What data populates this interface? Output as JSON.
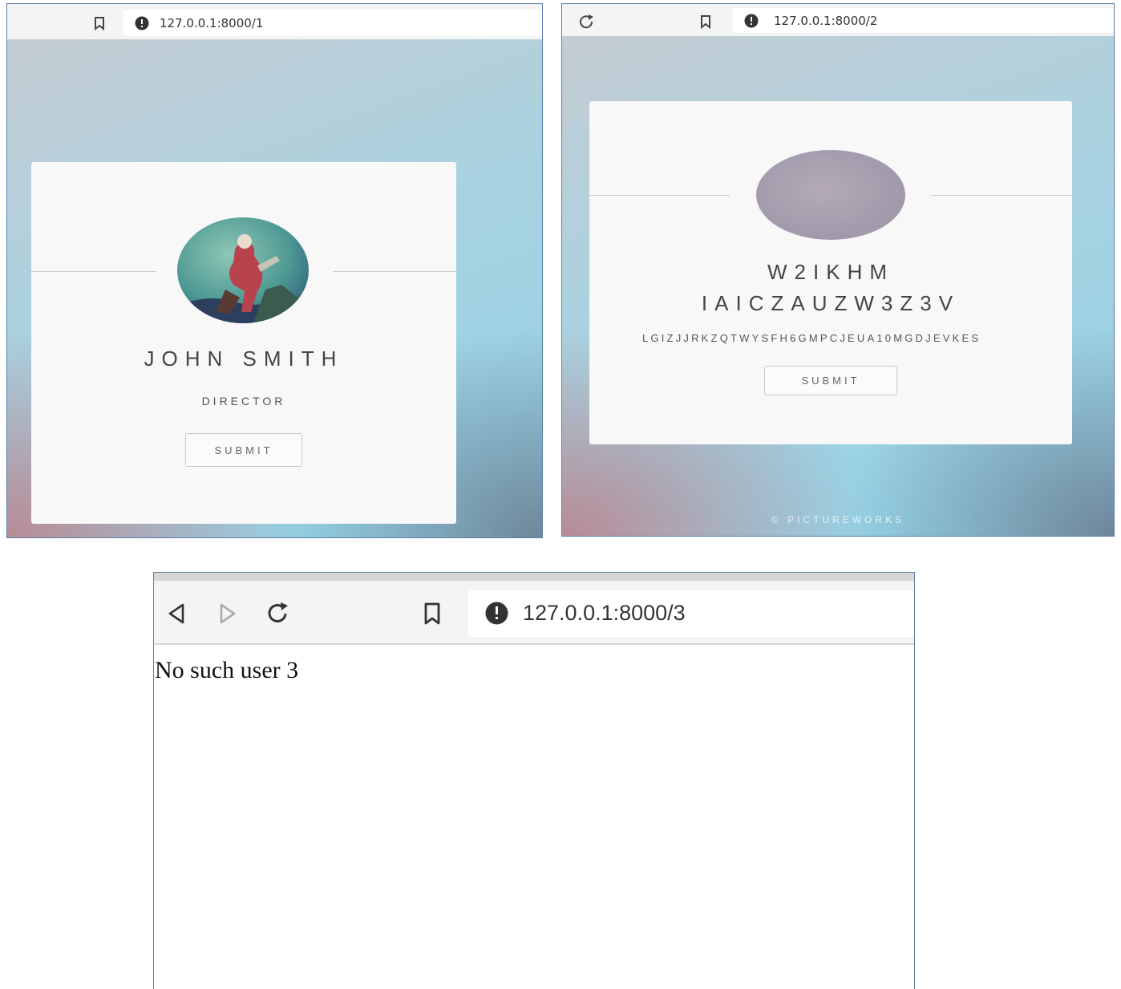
{
  "window1": {
    "url": "127.0.0.1:8000/1",
    "profile_name": "JOHN SMITH",
    "profile_title": "DIRECTOR",
    "submit_label": "SUBMIT"
  },
  "window2": {
    "url": "127.0.0.1:8000/2",
    "profile_name_line1": "W2IKHM",
    "profile_name_line2": "IAICZAUZW3Z3V",
    "profile_title": "LGIZJJRKZQTWYSFH6GMPCJEUA10MGDJEVKES",
    "submit_label": "SUBMIT",
    "footer": "© PICTUREWORKS"
  },
  "window3": {
    "url": "127.0.0.1:8000/3",
    "message": "No such user 3"
  },
  "colors": {
    "window_border": "#5b7fa6",
    "card_bg": "#f8f8f9",
    "avatar_placeholder": "#a79fb0"
  }
}
